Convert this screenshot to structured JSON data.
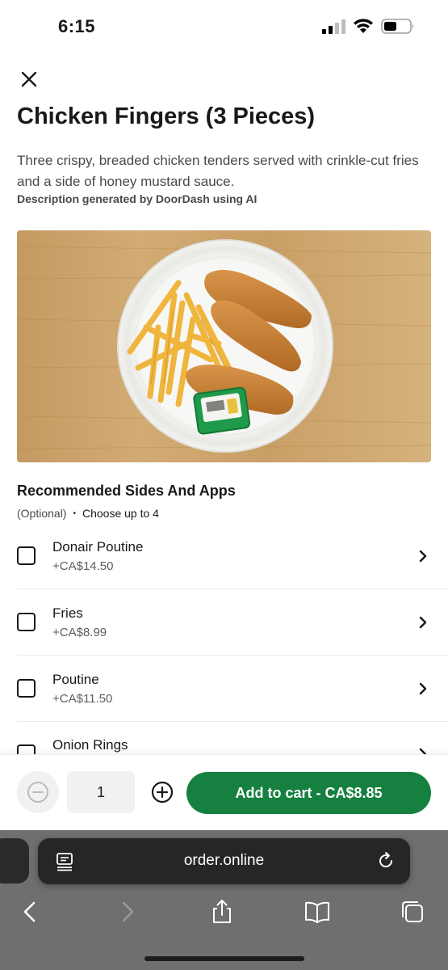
{
  "status_bar": {
    "time": "6:15"
  },
  "item": {
    "title": "Chicken Fingers (3 Pieces)",
    "description": "Three crispy, breaded chicken tenders served with crinkle-cut fries and a side of honey mustard sauce.",
    "ai_note": "Description generated by DoorDash using AI"
  },
  "section": {
    "title": "Recommended Sides And Apps",
    "optional": "(Optional)",
    "separator": "•",
    "limit": "Choose up to 4"
  },
  "options": [
    {
      "name": "Donair Poutine",
      "price": "+CA$14.50"
    },
    {
      "name": "Fries",
      "price": "+CA$8.99"
    },
    {
      "name": "Poutine",
      "price": "+CA$11.50"
    },
    {
      "name": "Onion Rings",
      "price": ""
    }
  ],
  "cart": {
    "quantity": "1",
    "add_label": "Add to cart - CA$8.85"
  },
  "browser": {
    "url": "order.online"
  },
  "colors": {
    "accent": "#15803f",
    "text": "#191919",
    "muted": "#494949"
  },
  "icons": [
    "close-icon",
    "chevron-right-icon",
    "minus-circle-icon",
    "plus-circle-icon",
    "reader-icon",
    "reload-icon",
    "back-icon",
    "forward-icon",
    "share-icon",
    "bookmarks-icon",
    "tabs-icon"
  ]
}
